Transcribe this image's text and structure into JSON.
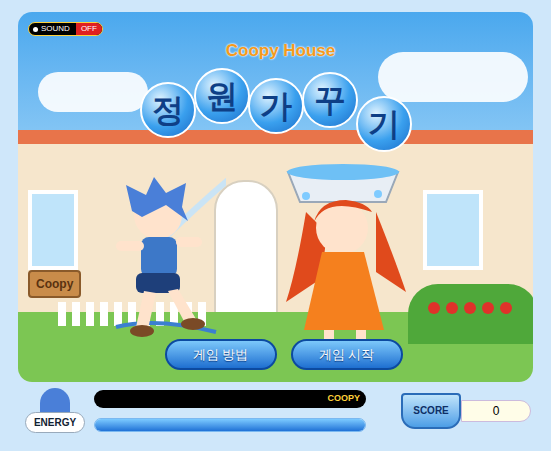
{
  "sound": {
    "label": "SOUND",
    "state": "OFF",
    "on": false
  },
  "logo": {
    "subtitle": "Coopy House",
    "title": "정원가꾸기"
  },
  "sign": "Coopy",
  "buttons": [
    {
      "label": "게임 방법"
    },
    {
      "label": "게임 시작"
    }
  ],
  "status_bar": {
    "name": "COOPY",
    "energy": {
      "label": "ENERGY",
      "level": 1
    },
    "score": {
      "label": "SCORE",
      "value": "0"
    }
  }
}
